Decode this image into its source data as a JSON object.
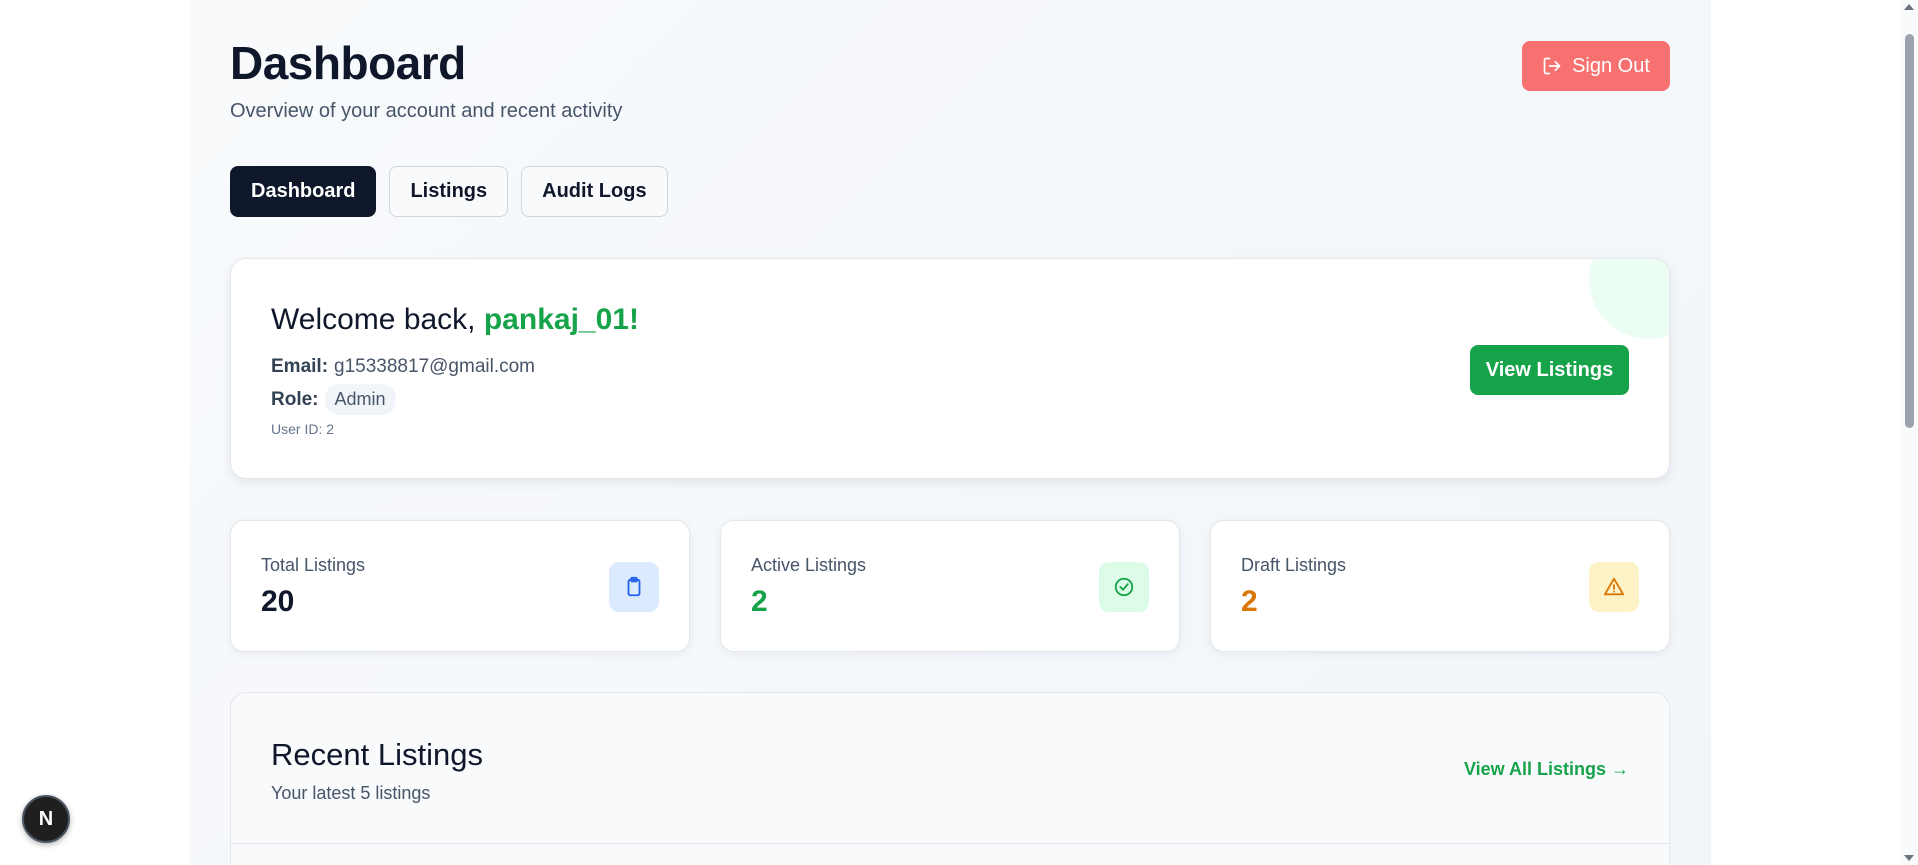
{
  "header": {
    "title": "Dashboard",
    "subtitle": "Overview of your account and recent activity",
    "signout_label": "Sign Out",
    "signout_icon": "logout-icon"
  },
  "tabs": [
    {
      "label": "Dashboard",
      "active": true
    },
    {
      "label": "Listings",
      "active": false
    },
    {
      "label": "Audit Logs",
      "active": false
    }
  ],
  "welcome": {
    "greeting": "Welcome back, ",
    "username": "pankaj_01!",
    "email_label": "Email:",
    "email_value": "g15338817@gmail.com",
    "role_label": "Role:",
    "role_value": "Admin",
    "user_id": "User ID: 2",
    "view_listings_label": "View Listings"
  },
  "stats": [
    {
      "label": "Total Listings",
      "value": "20",
      "value_color": "#0f172a",
      "icon": "clipboard-icon",
      "icon_bg": "#dbeafe",
      "icon_color": "#2563eb"
    },
    {
      "label": "Active Listings",
      "value": "2",
      "value_color": "#16a34a",
      "icon": "check-circle-icon",
      "icon_bg": "#dcfce7",
      "icon_color": "#16a34a"
    },
    {
      "label": "Draft Listings",
      "value": "2",
      "value_color": "#d97706",
      "icon": "warning-icon",
      "icon_bg": "#fef3c7",
      "icon_color": "#d97706"
    }
  ],
  "recent": {
    "title": "Recent Listings",
    "subtitle": "Your latest 5 listings",
    "view_all_label": "View All Listings →"
  },
  "dev_badge": "N",
  "colors": {
    "primary": "#16a34a",
    "danger": "#f87171",
    "dark": "#0f172a"
  }
}
